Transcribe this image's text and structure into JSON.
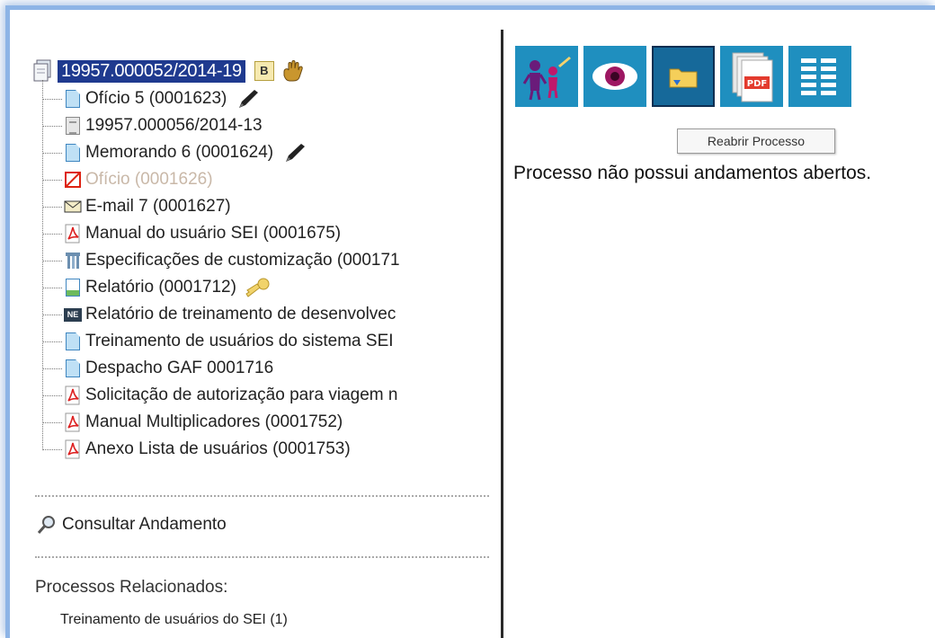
{
  "tree": {
    "root": {
      "label": "19957.000052/2014-19",
      "badge": "B"
    },
    "items": [
      {
        "label": "Ofício 5 (0001623)",
        "icon": "document-icon",
        "extra": "pen"
      },
      {
        "label": "19957.000056/2014-13",
        "icon": "process-icon"
      },
      {
        "label": "Memorando 6 (0001624)",
        "icon": "document-icon",
        "extra": "pen"
      },
      {
        "label": "Ofício (0001626)",
        "icon": "canceled-icon",
        "canceled": true
      },
      {
        "label": "E-mail 7 (0001627)",
        "icon": "email-icon"
      },
      {
        "label": "Manual do usuário SEI (0001675)",
        "icon": "pdf-icon"
      },
      {
        "label": "Especificações de customização (000171",
        "icon": "specification-icon"
      },
      {
        "label": "Relatório (0001712)",
        "icon": "report-icon",
        "extra": "key"
      },
      {
        "label": "Relatório de treinamento de desenvolvec",
        "icon": "ne-icon"
      },
      {
        "label": "Treinamento de usuários do sistema SEI",
        "icon": "document-icon"
      },
      {
        "label": "Despacho GAF 0001716",
        "icon": "document-icon"
      },
      {
        "label": "Solicitação de autorização para viagem n",
        "icon": "pdf-icon"
      },
      {
        "label": "Manual Multiplicadores (0001752)",
        "icon": "pdf-icon"
      },
      {
        "label": "Anexo Lista de usuários (0001753)",
        "icon": "pdf-icon"
      }
    ]
  },
  "consult": {
    "label": "Consultar Andamento"
  },
  "related": {
    "title": "Processos Relacionados:",
    "item": "Treinamento de usuários do SEI (1)"
  },
  "toolbar": {
    "buttons": [
      {
        "name": "assign-process-icon"
      },
      {
        "name": "view-eye-icon"
      },
      {
        "name": "reopen-folder-icon"
      },
      {
        "name": "pdf-pages-icon"
      },
      {
        "name": "list-icon"
      }
    ],
    "tooltip": "Reabrir Processo"
  },
  "main": {
    "message": "Processo não possui andamentos abertos."
  }
}
